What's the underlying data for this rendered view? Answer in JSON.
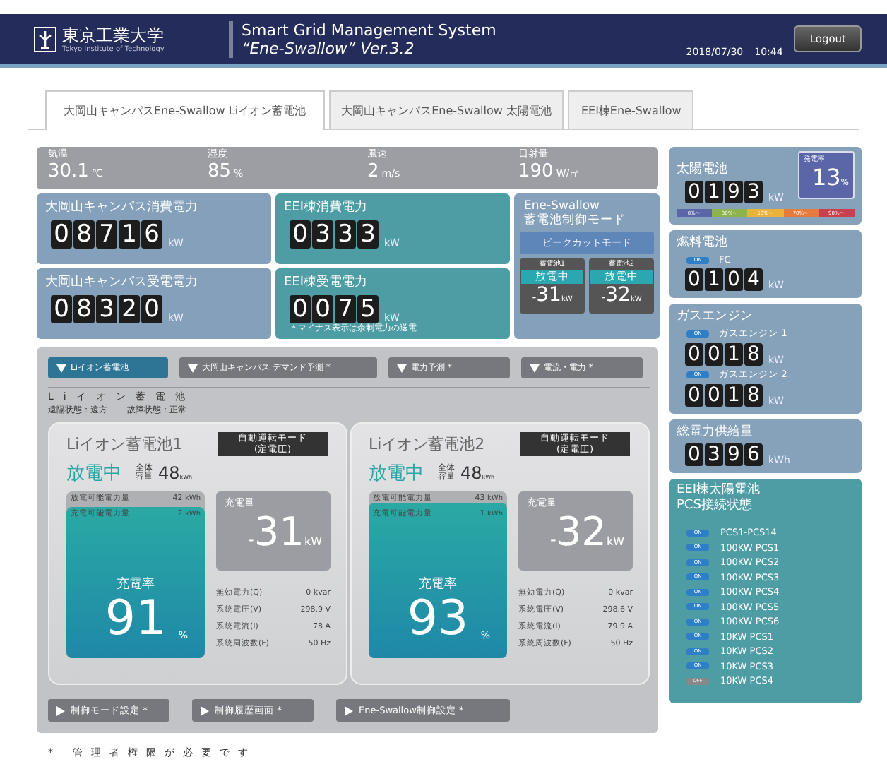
{
  "header": {
    "logo_jp": "東京工業大学",
    "logo_en": "Tokyo Institute of Technology",
    "title": "Smart Grid Management System",
    "subtitle": "“Ene-Swallow” Ver.3.2",
    "date": "2018/07/30",
    "time": "10:44",
    "logout": "Logout"
  },
  "tabs": [
    {
      "label": "大岡山キャンパスEne-Swallow Liイオン蓄電池",
      "selected": true
    },
    {
      "label": "大岡山キャンパスEne-Swallow 太陽電池",
      "selected": false
    },
    {
      "label": "EEI棟Ene-Swallow",
      "selected": false
    }
  ],
  "weather": [
    {
      "label": "気温",
      "value": "30.1",
      "unit": "℃"
    },
    {
      "label": "湿度",
      "value": "85",
      "unit": "%"
    },
    {
      "label": "風速",
      "value": "2",
      "unit": "m/s"
    },
    {
      "label": "日射量",
      "value": "190",
      "unit": "W/㎡"
    }
  ],
  "meters": [
    {
      "kind": "campus",
      "label": "大岡山キャンパス消費電力",
      "digits": [
        "0",
        "8",
        "7",
        "1",
        "6"
      ],
      "unit": "kW"
    },
    {
      "kind": "eei",
      "label": "EEI棟消費電力",
      "digits": [
        "0",
        "3",
        "3",
        "3"
      ],
      "unit": "kW"
    },
    {
      "kind": "campus",
      "label": "大岡山キャンパス受電電力",
      "digits": [
        "0",
        "8",
        "3",
        "2",
        "0"
      ],
      "unit": "kW"
    },
    {
      "kind": "eei",
      "label": "EEI棟受電電力",
      "digits": [
        "0",
        "0",
        "7",
        "5"
      ],
      "unit": "kW",
      "note": "＊マイナス表示は余剰電力の送電"
    }
  ],
  "control_mode": {
    "title_lines": [
      "Ene-Swallow",
      "蓄電池制御モード"
    ],
    "mode": "ピークカットモード",
    "batteries": [
      {
        "label": "蓄電池1",
        "status": "放電中",
        "sign": "-",
        "value": "31",
        "unit": "kW"
      },
      {
        "label": "蓄電池2",
        "status": "放電中",
        "sign": "-",
        "value": "32",
        "unit": "kW"
      }
    ]
  },
  "sections": [
    {
      "label": "Liイオン蓄電池",
      "selected": true
    },
    {
      "label": "大岡山キャンパス デマンド予測 *",
      "selected": false
    },
    {
      "label": "電力予測 *",
      "selected": false
    },
    {
      "label": "電流・電力 *",
      "selected": false
    }
  ],
  "panel": {
    "title": "Liイオン蓄電池",
    "status": [
      "遠隔状態：遠方",
      "故障状態：正常"
    ],
    "batteries": [
      {
        "name": "Liイオン蓄電池1",
        "mode_lines": [
          "自動運転モード",
          "(定電圧)"
        ],
        "status": "放電中",
        "cap_lines": [
          "全体",
          "容量"
        ],
        "capacity": "48",
        "cap_unit": "kWh",
        "discharge_label": "放電可能電力量",
        "discharge": "42",
        "discharge_unit": "kWh",
        "charge_label": "充電可能電力量",
        "charge": "2",
        "charge_unit": "kWh",
        "level": 0.91,
        "rate_label": "充電率",
        "rate": "91",
        "rate_unit": "%",
        "power_label": "充電量",
        "sign": "-",
        "power": "31",
        "power_unit": "kW",
        "stats": [
          {
            "label": "無効電力(Q)",
            "value": "0 kvar"
          },
          {
            "label": "系統電圧(V)",
            "value": "298.9 V"
          },
          {
            "label": "系統電流(I)",
            "value": "78 A"
          },
          {
            "label": "系統周波数(F)",
            "value": "50 Hz"
          }
        ]
      },
      {
        "name": "Liイオン蓄電池2",
        "mode_lines": [
          "自動運転モード",
          "(定電圧)"
        ],
        "status": "放電中",
        "cap_lines": [
          "全体",
          "容量"
        ],
        "capacity": "48",
        "cap_unit": "kWh",
        "discharge_label": "放電可能電力量",
        "discharge": "43",
        "discharge_unit": "kWh",
        "charge_label": "充電可能電力量",
        "charge": "1",
        "charge_unit": "kWh",
        "level": 0.93,
        "rate_label": "充電率",
        "rate": "93",
        "rate_unit": "%",
        "power_label": "充電量",
        "sign": "-",
        "power": "32",
        "power_unit": "kW",
        "stats": [
          {
            "label": "無効電力(Q)",
            "value": "0 kvar"
          },
          {
            "label": "系統電圧(V)",
            "value": "298.6 V"
          },
          {
            "label": "系統電流(I)",
            "value": "79.9 A"
          },
          {
            "label": "系統周波数(F)",
            "value": "50 Hz"
          }
        ]
      }
    ],
    "actions": [
      "制御モード設定 *",
      "制御履歴画面 *",
      "Ene-Swallow制御設定 *"
    ]
  },
  "footnote": "* 管理者権限が必要です",
  "solar": {
    "title": "太陽電池",
    "digits": [
      "0",
      "1",
      "9",
      "3"
    ],
    "unit": "kW",
    "rate_label": "発電率",
    "rate": "13",
    "rate_unit": "%",
    "scale": [
      {
        "label": "0%〜",
        "color": "#5b66a8"
      },
      {
        "label": "30%〜",
        "color": "#8db34c"
      },
      {
        "label": "50%〜",
        "color": "#eab23a"
      },
      {
        "label": "70%〜",
        "color": "#e57c3c"
      },
      {
        "label": "90%〜",
        "color": "#c8404e"
      }
    ]
  },
  "fuel": {
    "title": "燃料電池",
    "units": [
      {
        "status": "ON",
        "on": true,
        "name": "FC",
        "digits": [
          "0",
          "1",
          "0",
          "4"
        ],
        "unit": "kW"
      }
    ]
  },
  "gas": {
    "title": "ガスエンジン",
    "units": [
      {
        "status": "ON",
        "on": true,
        "name": "ガスエンジン 1",
        "digits": [
          "0",
          "0",
          "1",
          "8"
        ],
        "unit": "kW"
      },
      {
        "status": "ON",
        "on": true,
        "name": "ガスエンジン 2",
        "digits": [
          "0",
          "0",
          "1",
          "8"
        ],
        "unit": "kW"
      }
    ]
  },
  "total": {
    "title": "総電力供給量",
    "digits": [
      "0",
      "3",
      "9",
      "6"
    ],
    "unit": "kWh"
  },
  "pcs": {
    "title_lines": [
      "EEI棟太陽電池",
      "PCS接続状態"
    ],
    "items": [
      {
        "status": "ON",
        "on": true,
        "name": "PCS1-PCS14"
      },
      {
        "status": "ON",
        "on": true,
        "name": "100KW PCS1"
      },
      {
        "status": "ON",
        "on": true,
        "name": "100KW PCS2"
      },
      {
        "status": "ON",
        "on": true,
        "name": "100KW PCS3"
      },
      {
        "status": "ON",
        "on": true,
        "name": "100KW PCS4"
      },
      {
        "status": "ON",
        "on": true,
        "name": "100KW PCS5"
      },
      {
        "status": "ON",
        "on": true,
        "name": "100KW PCS6"
      },
      {
        "status": "ON",
        "on": true,
        "name": "10KW PCS1"
      },
      {
        "status": "ON",
        "on": true,
        "name": "10KW PCS2"
      },
      {
        "status": "ON",
        "on": true,
        "name": "10KW PCS3"
      },
      {
        "status": "OFF",
        "on": false,
        "name": "10KW PCS4"
      }
    ]
  }
}
